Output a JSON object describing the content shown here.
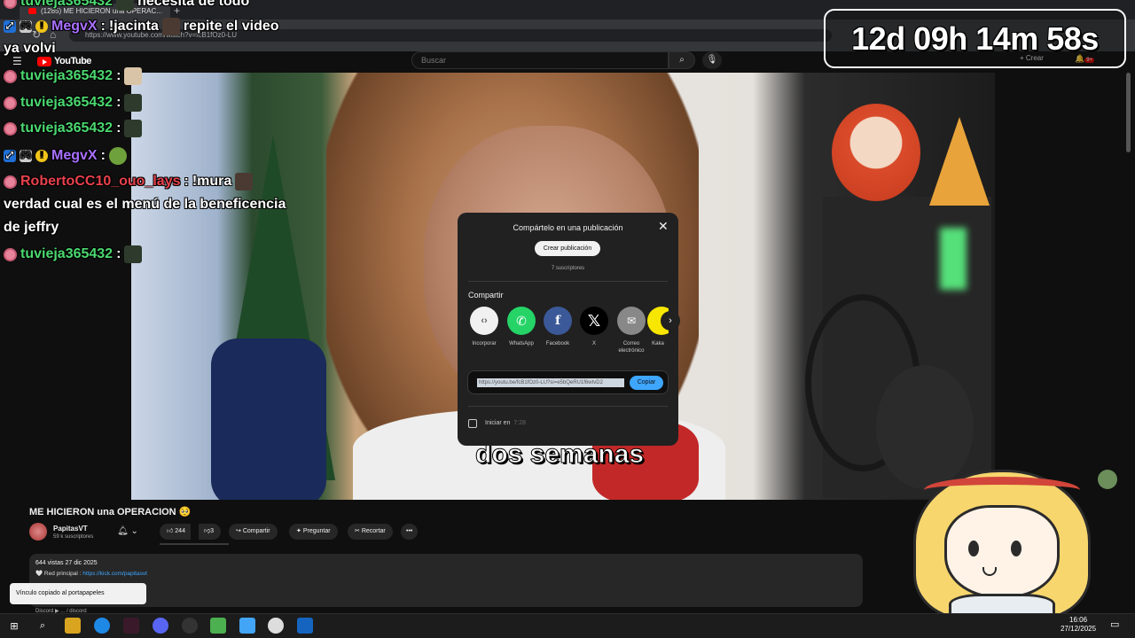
{
  "browser": {
    "tab_title": "(1285) ME HICIERON una OPERAC...",
    "new_tab": "+",
    "url": "https://www.youtube.com/watch?v=fcB1fOz0-LU"
  },
  "youtube": {
    "logo": "YouTube",
    "search_placeholder": "Buscar",
    "create_label": "+ Crear",
    "notif_count": "9+"
  },
  "timer": {
    "text": "12d 09h 14m 58s"
  },
  "video": {
    "subtitle": "dos semanas"
  },
  "chat": [
    {
      "user": "tuvieja365432",
      "text": "necesita de todo"
    },
    {
      "user": "MegvX",
      "text": "!jacinta",
      "extra": "repite el video"
    },
    {
      "user": "",
      "text": "ya volvi"
    },
    {
      "user": "tuvieja365432",
      "text": ""
    },
    {
      "user": "tuvieja365432",
      "text": ""
    },
    {
      "user": "tuvieja365432",
      "text": ""
    },
    {
      "user": "MegvX",
      "text": ""
    },
    {
      "user": "RobertoCC10_ouo_lays",
      "text": "!mura"
    },
    {
      "user": "",
      "text": "verdad cual es el menú de la beneficencia de jeffry"
    },
    {
      "user": "tuvieja365432",
      "text": ""
    }
  ],
  "chat_separator": ":",
  "share_dialog": {
    "title": "Compártelo en una publicación",
    "create_post": "Crear publicación",
    "subscribers": "7 suscriptores",
    "share_heading": "Compartir",
    "options": [
      "Incorporar",
      "WhatsApp",
      "Facebook",
      "X",
      "Correo electrónico",
      "Kaka"
    ],
    "icons": [
      "embed-icon",
      "whatsapp-icon",
      "facebook-icon",
      "x-icon",
      "mail-icon",
      "kakao-icon"
    ],
    "glyphs": [
      "‹›",
      "✆",
      "f",
      "𝕏",
      "✉",
      ""
    ],
    "url": "https://youtu.be/fcB1fOz0-LU?si=e5bQeRU1f6wtvD2",
    "copy": "Copiar",
    "start_at": "Iniciar en",
    "start_time": "7:28",
    "close": "✕",
    "next": "›"
  },
  "video_info": {
    "title": "ME HICIERON una OPERACION 🥺",
    "channel": "PapitasVT",
    "subscribers": "59 k suscriptores",
    "likes": "244",
    "dislikes": "3",
    "share": "Compartir",
    "ask": "Preguntar",
    "clip": "Recortar",
    "more": "•••",
    "views_date": "644 vistas  27 dic 2025",
    "main_label": "🤍 Red principal :",
    "main_link": "https://kick.com/papitasvt",
    "discord": "Discord ▶ ... / discord"
  },
  "toast": "Vínculo copiado al portapapeles",
  "taskbar": {
    "time": "16:06",
    "date": "27/12/2025"
  },
  "colors": {
    "accent_blue": "#3ea6ff",
    "yt_red": "#ff0000",
    "chat_green": "#4bd870",
    "chat_purple": "#a970ff",
    "chat_red": "#e8414d"
  }
}
